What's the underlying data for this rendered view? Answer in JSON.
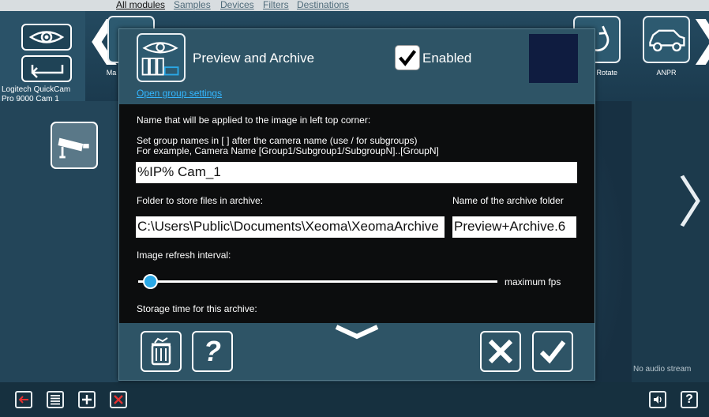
{
  "top_tabs": [
    {
      "label": "All modules",
      "active": true
    },
    {
      "label": "Samples",
      "active": false
    },
    {
      "label": "Devices",
      "active": false
    },
    {
      "label": "Filters",
      "active": false
    },
    {
      "label": "Destinations",
      "active": false
    }
  ],
  "camera": {
    "label_line1": "Logitech QuickCam",
    "label_line2": "Pro 9000 Cam  1"
  },
  "modules": {
    "visible_labels": [
      {
        "text": "Ma"
      },
      {
        "text": "e Rotate"
      },
      {
        "text": "ANPR"
      }
    ]
  },
  "dialog": {
    "title": "Preview and Archive",
    "enabled_label": "Enabled",
    "enabled": true,
    "open_group_link": "Open group settings",
    "name_label": "Name that will be applied to the image in left top corner:",
    "group_hint_1": "Set group names in [ ] after the camera name (use / for subgroups)",
    "group_hint_2": "For example, Camera Name [Group1/Subgroup1/SubgroupN]..[GroupN]",
    "name_value": "%IP% Cam_1",
    "folder_label": "Folder to store files in archive:",
    "folder_value": "C:\\Users\\Public\\Documents\\Xeoma\\XeomaArchive",
    "archive_name_label": "Name of the archive folder",
    "archive_name_value": "Preview+Archive.6",
    "refresh_label": "Image refresh interval:",
    "refresh_value_label": "maximum fps",
    "refresh_level": 0.02,
    "storage_label": "Storage time for this archive:"
  },
  "status": {
    "no_audio": "No audio stream"
  },
  "colors": {
    "accent": "#2aa8e6",
    "link": "#33b6ff",
    "dialog_bg": "#2e5466"
  }
}
